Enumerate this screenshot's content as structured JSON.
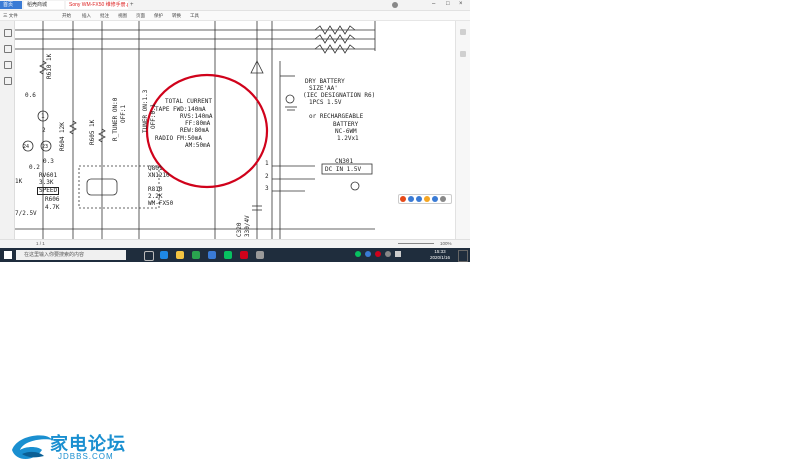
{
  "window": {
    "tabs": [
      {
        "label": "首页"
      },
      {
        "label": "稻壳商城"
      },
      {
        "label": "Sony WM-FX50 维修手册.pdf"
      }
    ],
    "menu": [
      "三 文件",
      "开始",
      "插入",
      "批注",
      "视图",
      "页面",
      "保护",
      "转换",
      "工具"
    ],
    "status": {
      "page": "1 / 1",
      "zoom": "100%"
    }
  },
  "schematic": {
    "left_labels": [
      "0.6",
      "R610 1K",
      "R604 12K",
      "R605 1K",
      "RV601",
      "3.3K",
      "SPEED",
      "R606",
      "4.7K",
      "7/2.5V",
      "0.3",
      "0.2",
      "R_TUNER ON:0",
      "OFF:1",
      "TUNER ON:1.3",
      "OFF:0.1",
      "1K",
      "1",
      "2",
      "24",
      "23"
    ],
    "transistor": {
      "ref": "Q801",
      "part": "XN1210",
      "resistor": "R810",
      "value": "2.2K",
      "model": "WM-FX50"
    },
    "cap": {
      "ref": "C320",
      "value": "330/4V"
    },
    "total_current": {
      "title": "TOTAL CURRENT",
      "lines": [
        "TAPE FWD:140mA",
        "RVS:140mA",
        "FF:80mA",
        "REW:80mA",
        "RADIO FM:50mA",
        "AM:50mA"
      ]
    },
    "battery": {
      "lines": [
        "DRY BATTERY",
        "SIZE'AA'",
        "(IEC DESIGNATION R6)",
        "1PCS 1.5V",
        "or RECHARGEABLE",
        "BATTERY",
        "NC-6WM",
        "1.2Vx1"
      ]
    },
    "connector": {
      "ref": "CN301",
      "label": "DC IN 1.5V",
      "pins": [
        "1",
        "2",
        "3"
      ]
    }
  },
  "taskbar": {
    "search_placeholder": "在这里输入你要搜索的内容",
    "time": "15:33",
    "date": "2020/1/16"
  },
  "watermark": {
    "brand": "家电论坛",
    "url": "JDBBS.COM"
  },
  "colors": {
    "circle": "#d0021b",
    "taskbar": "#1f2d3d",
    "accent": "#3a7bd5",
    "logo": "#1a8fd0"
  }
}
